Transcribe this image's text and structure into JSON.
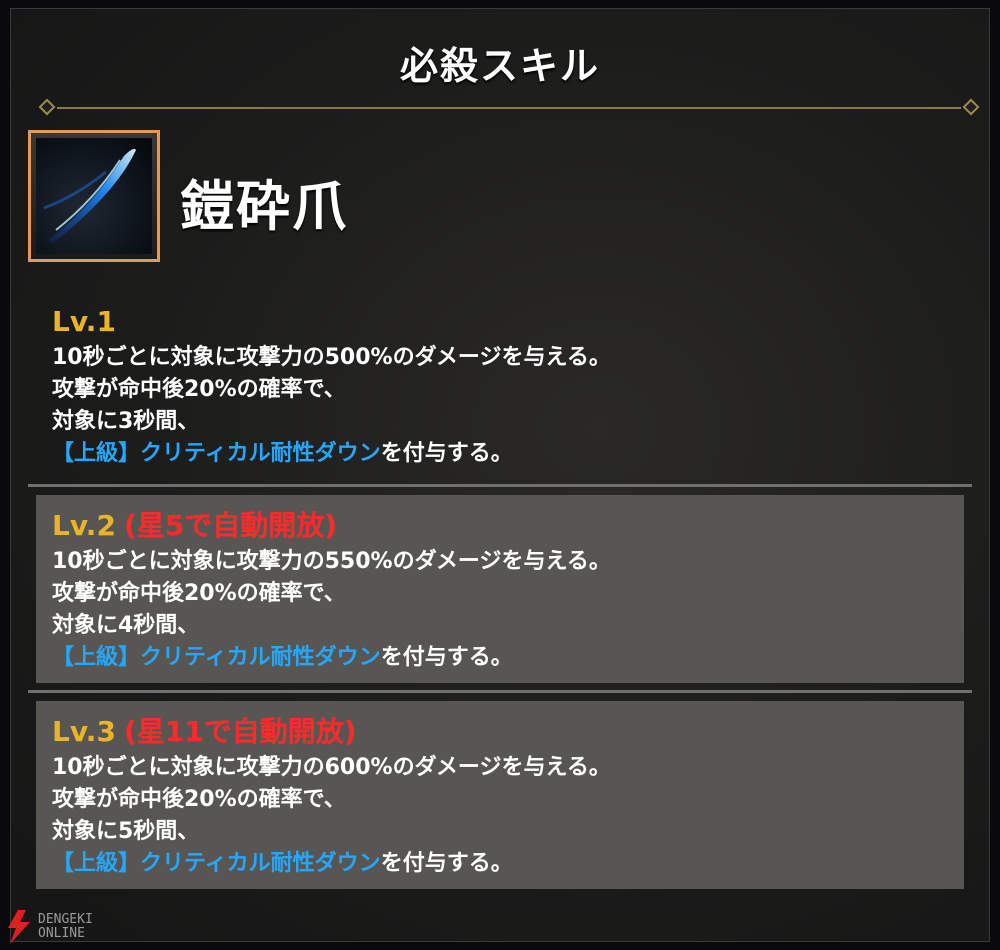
{
  "title": "必殺スキル",
  "skill": {
    "name": "鎧砕爪",
    "icon": "blue-claw-slash-icon"
  },
  "levels": [
    {
      "level": "Lv.1",
      "unlock": "",
      "lines": [
        "10秒ごとに対象に攻撃力の500%のダメージを与える。",
        "攻撃が命中後20%の確率で、",
        "対象に3秒間、"
      ],
      "effect": "【上級】クリティカル耐性ダウン",
      "effect_suffix": "を付与する。"
    },
    {
      "level": "Lv.2",
      "unlock": "(星5で自動開放)",
      "lines": [
        "10秒ごとに対象に攻撃力の550%のダメージを与える。",
        "攻撃が命中後20%の確率で、",
        "対象に4秒間、"
      ],
      "effect": "【上級】クリティカル耐性ダウン",
      "effect_suffix": "を付与する。"
    },
    {
      "level": "Lv.3",
      "unlock": "(星11で自動開放)",
      "lines": [
        "10秒ごとに対象に攻撃力の600%のダメージを与える。",
        "攻撃が命中後20%の確率で、",
        "対象に5秒間、"
      ],
      "effect": "【上級】クリティカル耐性ダウン",
      "effect_suffix": "を付与する。"
    }
  ],
  "watermark": {
    "line1": "DENGEKI",
    "line2": "ONLINE",
    "icon": "lightning-bolt-icon"
  },
  "colors": {
    "level_label": "#e8b52a",
    "unlock_text": "#ff2a2a",
    "effect_text": "#24a8ff",
    "icon_border": "#e19a5e",
    "locked_box": "#585653"
  }
}
